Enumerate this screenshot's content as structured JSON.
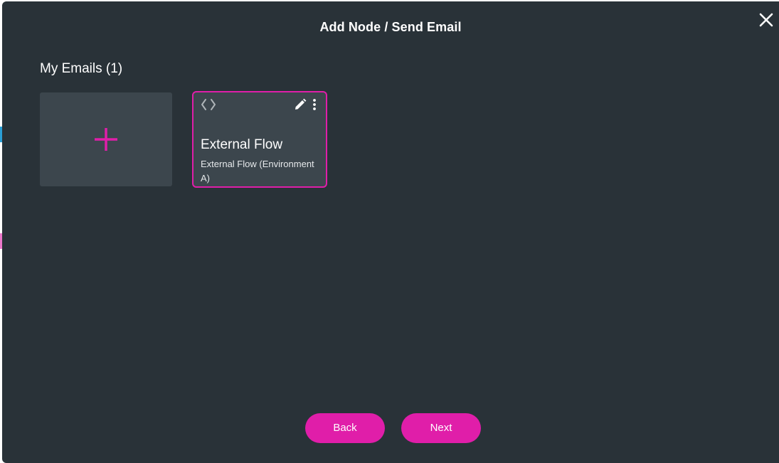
{
  "modal": {
    "title": "Add Node / Send Email",
    "close_icon": "close-icon"
  },
  "emails": {
    "heading": "My Emails (1)",
    "add_icon": "plus-icon",
    "cards": [
      {
        "title": "External Flow",
        "subtitle": "External Flow (Environment A)",
        "icons": [
          "code-icon",
          "edit-icon",
          "more-vertical-icon"
        ]
      }
    ]
  },
  "footer": {
    "back_label": "Back",
    "next_label": "Next"
  },
  "colors": {
    "modal_bg": "#293238",
    "card_bg": "#3c464d",
    "accent": "#e01ea9",
    "text": "#ffffff"
  }
}
